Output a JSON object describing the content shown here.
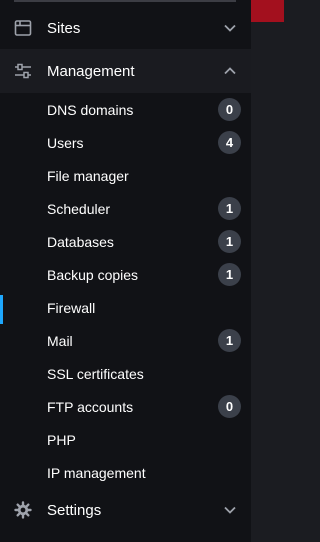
{
  "sidebar": {
    "groups": {
      "sites": {
        "label": "Sites",
        "icon": "calendar-icon",
        "chevron": "chevron-down-icon"
      },
      "management": {
        "label": "Management",
        "icon": "sliders-icon",
        "chevron": "chevron-up-icon"
      },
      "settings": {
        "label": "Settings",
        "icon": "gear-icon",
        "chevron": "chevron-down-icon"
      }
    },
    "management_items": [
      {
        "label": "DNS domains",
        "badge": "0"
      },
      {
        "label": "Users",
        "badge": "4"
      },
      {
        "label": "File manager",
        "badge": ""
      },
      {
        "label": "Scheduler",
        "badge": "1"
      },
      {
        "label": "Databases",
        "badge": "1"
      },
      {
        "label": "Backup copies",
        "badge": "1"
      },
      {
        "label": "Firewall",
        "badge": "",
        "active": true
      },
      {
        "label": "Mail",
        "badge": "1"
      },
      {
        "label": "SSL certificates",
        "badge": ""
      },
      {
        "label": "FTP accounts",
        "badge": "0"
      },
      {
        "label": "PHP",
        "badge": ""
      },
      {
        "label": "IP management",
        "badge": ""
      }
    ]
  },
  "colors": {
    "sidebar_bg": "#111216",
    "header_active_bg": "#1a1b20",
    "badge_bg": "#3b404a",
    "active_indicator": "#1ea7fd",
    "accent_red": "#a3101e"
  }
}
